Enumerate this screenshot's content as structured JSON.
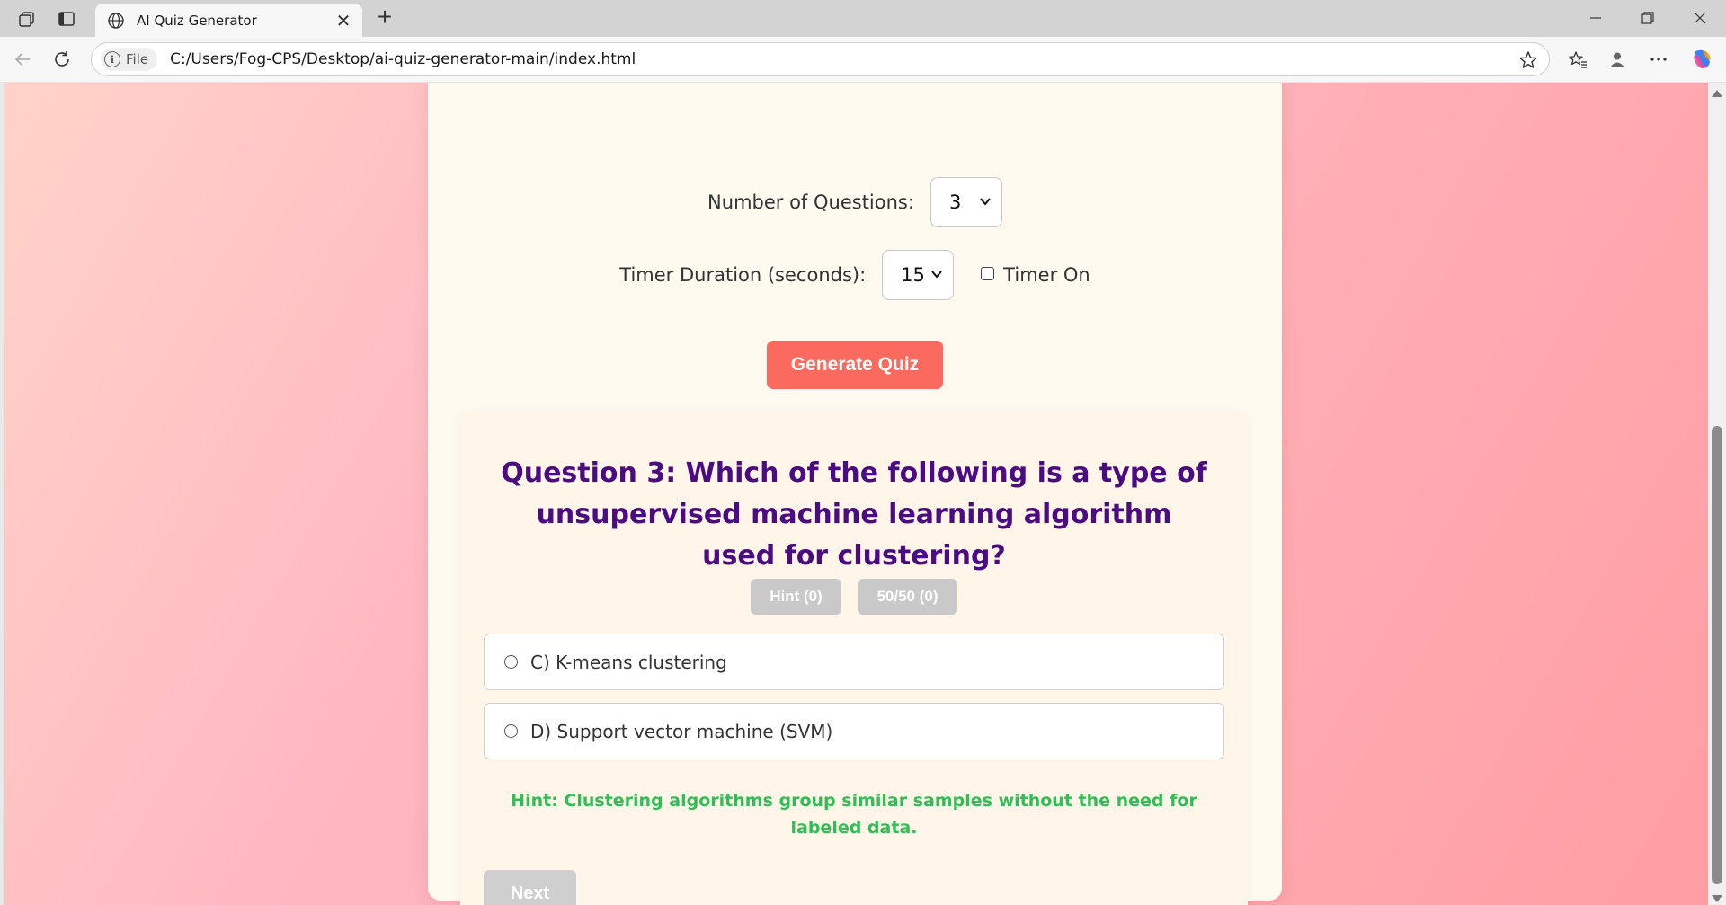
{
  "browser": {
    "tab_title": "AI Quiz Generator",
    "file_chip": "File",
    "url": "C:/Users/Fog-CPS/Desktop/ai-quiz-generator-main/index.html"
  },
  "settings": {
    "num_questions_label": "Number of Questions:",
    "num_questions_value": "3",
    "timer_label": "Timer Duration (seconds):",
    "timer_value": "15",
    "timer_on_label": "Timer On",
    "timer_on_checked": false,
    "generate_label": "Generate Quiz"
  },
  "quiz": {
    "question": "Question 3: Which of the following is a type of unsupervised machine learning algorithm used for clustering?",
    "hint_button": "Hint (0)",
    "fifty_button": "50/50 (0)",
    "options": [
      "C) K-means clustering",
      "D) Support vector machine (SVM)"
    ],
    "hint_text": "Hint: Clustering algorithms group similar samples without the need for labeled data.",
    "next_label": "Next"
  },
  "colors": {
    "generate_button": "#fa6a5e",
    "question_text": "#4b0b82",
    "hint_text": "#2fbf55",
    "disabled_button": "#c9c9c9"
  }
}
